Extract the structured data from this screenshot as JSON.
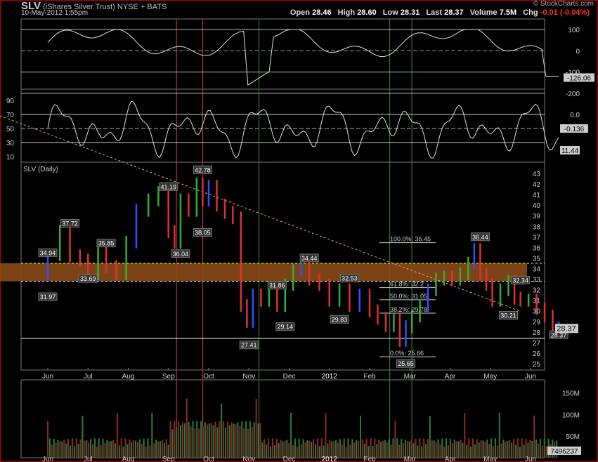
{
  "header": {
    "symbol": "SLV",
    "name": "(iShares Silver Trust) NYSE + BATS",
    "datetime": "10-May-2012 1:55pm",
    "brand": "© StockCharts.com",
    "open_label": "Open",
    "open": "28.46",
    "high_label": "High",
    "high": "28.60",
    "low_label": "Low",
    "low": "28.31",
    "last_label": "Last",
    "last": "28.37",
    "volume_label": "Volume",
    "volume": "7.5M",
    "chg_label": "Chg",
    "chg": "-0.01 (-0.04%)",
    "chg_color": "#ff3030"
  },
  "chart_data": {
    "type": "candlestick",
    "title": "SLV (Daily)",
    "x_months": [
      "Jun",
      "Jul",
      "Aug",
      "Sep",
      "Oct",
      "Nov",
      "Dec",
      "2012",
      "Feb",
      "Mar",
      "Apr",
      "May",
      "Jun"
    ],
    "price": {
      "ylim": [
        25,
        43
      ],
      "y_ticks": [
        25,
        26,
        27,
        28,
        29,
        30,
        31,
        32,
        33,
        34,
        35,
        36,
        37,
        38,
        39,
        40,
        41,
        42,
        43
      ],
      "series": [
        {
          "m": 0.0,
          "c": 33.5
        },
        {
          "m": 0.3,
          "c": 35.3
        },
        {
          "m": 0.55,
          "c": 37.5
        },
        {
          "m": 0.8,
          "c": 35.2
        },
        {
          "m": 1.0,
          "c": 34.8
        },
        {
          "m": 1.25,
          "c": 33.5
        },
        {
          "m": 1.45,
          "c": 35.8
        },
        {
          "m": 1.7,
          "c": 34.2
        },
        {
          "m": 1.95,
          "c": 33.5
        },
        {
          "m": 2.2,
          "c": 36.5
        },
        {
          "m": 2.5,
          "c": 39.5
        },
        {
          "m": 2.75,
          "c": 40.5
        },
        {
          "m": 3.0,
          "c": 41.2
        },
        {
          "m": 3.15,
          "c": 37.5
        },
        {
          "m": 3.3,
          "c": 36.5
        },
        {
          "m": 3.5,
          "c": 40.5
        },
        {
          "m": 3.7,
          "c": 39.5
        },
        {
          "m": 3.85,
          "c": 42.0
        },
        {
          "m": 4.0,
          "c": 40.5
        },
        {
          "m": 4.2,
          "c": 41.8
        },
        {
          "m": 4.4,
          "c": 40.0
        },
        {
          "m": 4.6,
          "c": 39.3
        },
        {
          "m": 4.8,
          "c": 38.8
        },
        {
          "m": 4.95,
          "c": 30.5
        },
        {
          "m": 5.1,
          "c": 29.0
        },
        {
          "m": 5.3,
          "c": 31.5
        },
        {
          "m": 5.5,
          "c": 31.0
        },
        {
          "m": 5.7,
          "c": 32.0
        },
        {
          "m": 5.9,
          "c": 30.5
        },
        {
          "m": 6.1,
          "c": 32.5
        },
        {
          "m": 6.3,
          "c": 33.8
        },
        {
          "m": 6.5,
          "c": 34.3
        },
        {
          "m": 6.75,
          "c": 33.0
        },
        {
          "m": 7.0,
          "c": 32.5
        },
        {
          "m": 7.25,
          "c": 31.0
        },
        {
          "m": 7.5,
          "c": 32.0
        },
        {
          "m": 7.75,
          "c": 30.5
        },
        {
          "m": 8.0,
          "c": 31.5
        },
        {
          "m": 8.2,
          "c": 30.0
        },
        {
          "m": 8.4,
          "c": 29.3
        },
        {
          "m": 8.6,
          "c": 28.6
        },
        {
          "m": 8.75,
          "c": 29.2
        },
        {
          "m": 8.9,
          "c": 27.2
        },
        {
          "m": 9.05,
          "c": 28.5
        },
        {
          "m": 9.25,
          "c": 29.5
        },
        {
          "m": 9.45,
          "c": 30.5
        },
        {
          "m": 9.65,
          "c": 32.0
        },
        {
          "m": 9.85,
          "c": 33.0
        },
        {
          "m": 10.05,
          "c": 33.2
        },
        {
          "m": 10.25,
          "c": 33.0
        },
        {
          "m": 10.45,
          "c": 33.5
        },
        {
          "m": 10.6,
          "c": 34.5
        },
        {
          "m": 10.75,
          "c": 35.8
        },
        {
          "m": 10.9,
          "c": 33.5
        },
        {
          "m": 11.05,
          "c": 32.5
        },
        {
          "m": 11.25,
          "c": 31.0
        },
        {
          "m": 11.45,
          "c": 32.0
        },
        {
          "m": 11.6,
          "c": 32.8
        },
        {
          "m": 11.75,
          "c": 31.2
        },
        {
          "m": 11.95,
          "c": 31.0
        },
        {
          "m": 12.15,
          "c": 31.0
        },
        {
          "m": 12.35,
          "c": 30.2
        },
        {
          "m": 12.55,
          "c": 29.5
        },
        {
          "m": 12.7,
          "c": 28.4
        }
      ],
      "annotations": [
        {
          "label": "34.94",
          "m": 0.0,
          "v": 34.94,
          "pos": "above"
        },
        {
          "label": "31.97",
          "m": 0.0,
          "v": 31.97,
          "pos": "below"
        },
        {
          "label": "37.72",
          "m": 0.55,
          "v": 37.72,
          "pos": "above"
        },
        {
          "label": "33.69",
          "m": 1.0,
          "v": 33.69,
          "pos": "below"
        },
        {
          "label": "35.85",
          "m": 1.45,
          "v": 35.85,
          "pos": "above"
        },
        {
          "label": "41.19",
          "m": 3.0,
          "v": 41.19,
          "pos": "above"
        },
        {
          "label": "36.04",
          "m": 3.3,
          "v": 36.04,
          "pos": "below"
        },
        {
          "label": "42.78",
          "m": 3.85,
          "v": 42.78,
          "pos": "above"
        },
        {
          "label": "38.05",
          "m": 3.85,
          "v": 38.05,
          "pos": "below"
        },
        {
          "label": "27.41",
          "m": 5.0,
          "v": 27.41,
          "pos": "below"
        },
        {
          "label": "31.86",
          "m": 5.7,
          "v": 31.86,
          "pos": "above"
        },
        {
          "label": "29.14",
          "m": 5.9,
          "v": 29.14,
          "pos": "below"
        },
        {
          "label": "34.44",
          "m": 6.5,
          "v": 34.44,
          "pos": "above"
        },
        {
          "label": "32.53",
          "m": 7.5,
          "v": 32.53,
          "pos": "above"
        },
        {
          "label": "29.83",
          "m": 7.25,
          "v": 29.83,
          "pos": "below"
        },
        {
          "label": "25.65",
          "m": 8.9,
          "v": 25.65,
          "pos": "below"
        },
        {
          "label": "36.44",
          "m": 10.75,
          "v": 36.44,
          "pos": "above"
        },
        {
          "label": "32.34",
          "m": 11.75,
          "v": 32.34,
          "pos": "above"
        },
        {
          "label": "30.21",
          "m": 11.45,
          "v": 30.21,
          "pos": "below"
        },
        {
          "label": "28.37",
          "m": 12.7,
          "v": 28.37,
          "pos": "below"
        }
      ],
      "fib_levels": [
        {
          "label": "100.0%: 36.45",
          "v": 36.45
        },
        {
          "label": "61.8%: 32.2",
          "v": 32.2
        },
        {
          "label": "50.0%: 31.05",
          "v": 31.05
        },
        {
          "label": "38.2%: 29.78",
          "v": 29.78
        },
        {
          "label": "0.0%: 25.66",
          "v": 25.66
        }
      ],
      "last_price": "28.37",
      "support_band": [
        32.8,
        34.5
      ]
    },
    "cci": {
      "ticks": [
        100,
        0,
        -100,
        -200
      ],
      "last": "-126.06"
    },
    "stoch": {
      "ticks": [
        90,
        70,
        50,
        30,
        10
      ],
      "right_ticks": [
        "0.0",
        "-0.136"
      ],
      "last": "11.44"
    },
    "volume": {
      "ticks": [
        "150M",
        "100M",
        "50M"
      ],
      "last": "7496237"
    }
  }
}
